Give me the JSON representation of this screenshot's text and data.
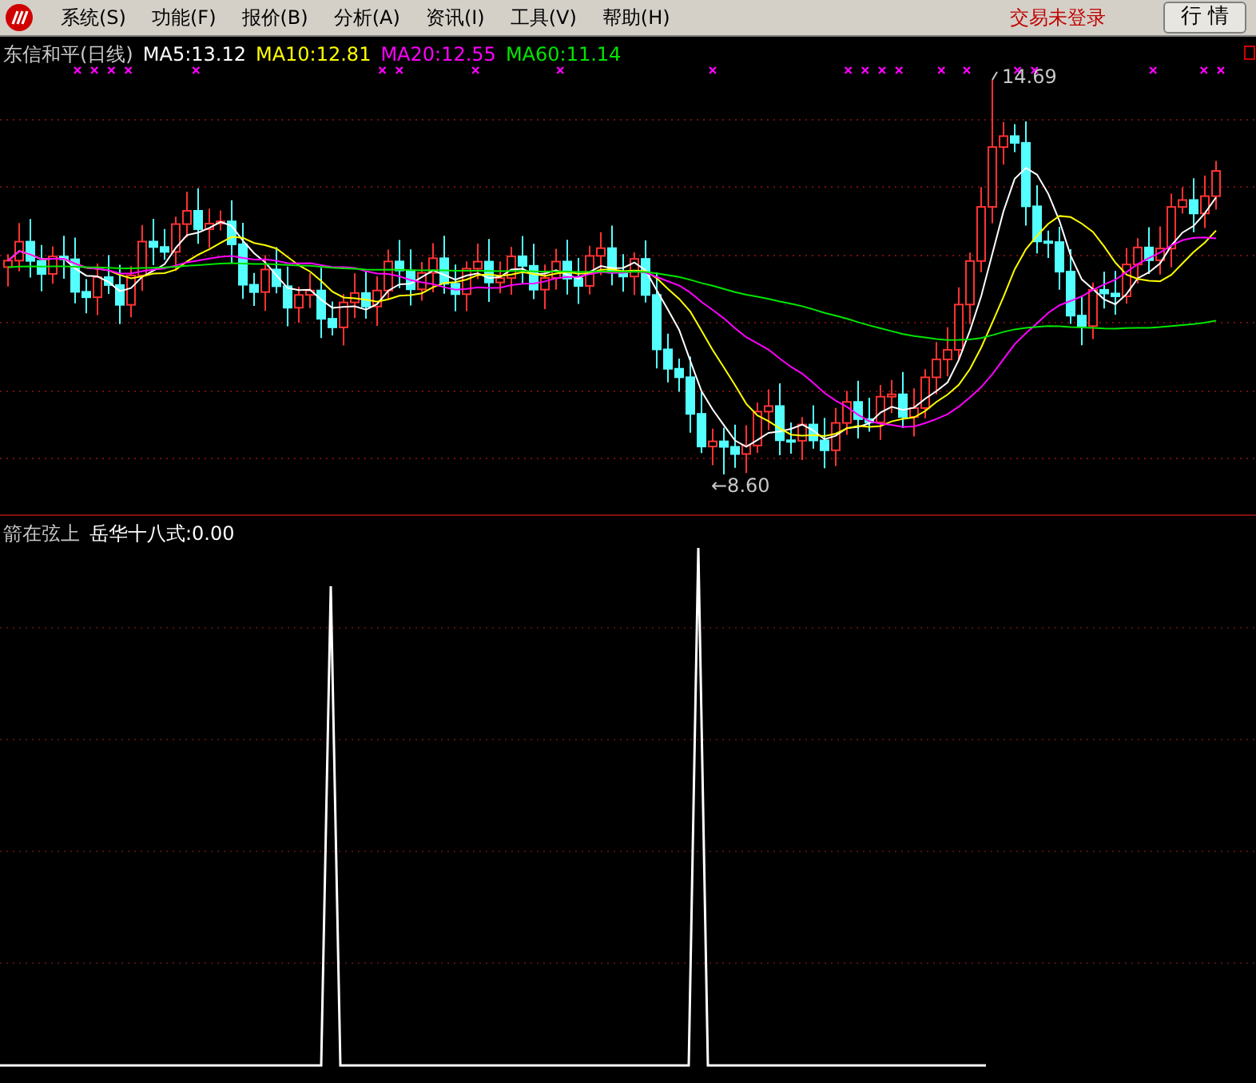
{
  "menu": [
    {
      "label": "系统(S)"
    },
    {
      "label": "功能(F)"
    },
    {
      "label": "报价(B)"
    },
    {
      "label": "分析(A)"
    },
    {
      "label": "资讯(I)"
    },
    {
      "label": "工具(V)"
    },
    {
      "label": "帮助(H)"
    }
  ],
  "login_status": "交易未登录",
  "quote_button": "行 情",
  "main_chart": {
    "title": "东信和平(日线)",
    "moving_averages": [
      {
        "label": "MA5:13.12",
        "color": "#ffffff"
      },
      {
        "label": "MA10:12.81",
        "color": "#ffff00"
      },
      {
        "label": "MA20:12.55",
        "color": "#ff00ff"
      },
      {
        "label": "MA60:11.14",
        "color": "#00e600"
      }
    ],
    "high_label": "14.69",
    "low_label": "←8.60"
  },
  "indicator": {
    "title": "箭在弦上",
    "value": "岳华十八式:0.00"
  }
}
